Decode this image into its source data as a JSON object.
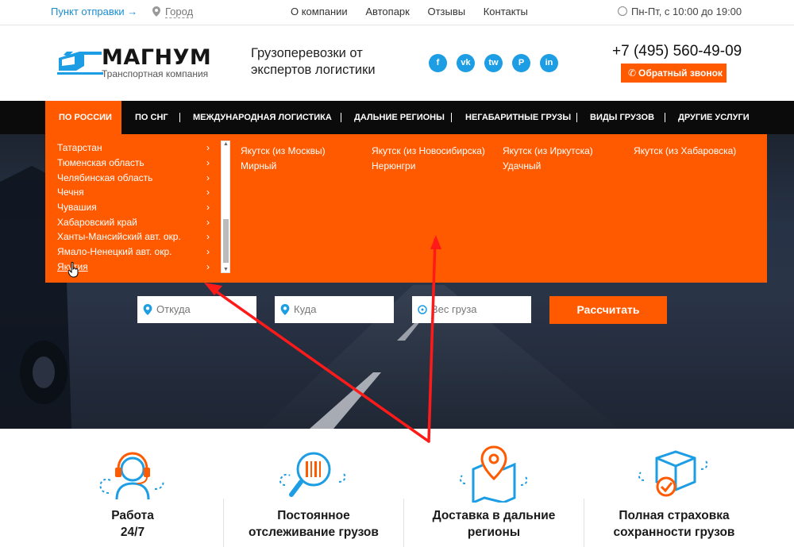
{
  "topbar": {
    "ship_point": "Пункт отправки →",
    "city": "Город",
    "nav": [
      "О компании",
      "Автопарк",
      "Отзывы",
      "Контакты"
    ],
    "hours": "Пн-Пт, с 10:00 до 19:00"
  },
  "header": {
    "brand": "МАГНУМ",
    "brand_sub": "Транспортная компания",
    "slogan_line1": "Грузоперевозки от",
    "slogan_line2": "экспертов логистики",
    "social": [
      "f",
      "vk",
      "tw",
      "P",
      "in"
    ],
    "phone": "+7 (495) 560-49-09",
    "callback": "Обратный звонок"
  },
  "mainnav": {
    "items": [
      "По России",
      "По СНГ",
      "Международная логистика",
      "Дальние регионы",
      "Негабаритные грузы",
      "Виды грузов",
      "Другие услуги"
    ]
  },
  "dropdown": {
    "regions": [
      "Татарстан",
      "Тюменская область",
      "Челябинская область",
      "Чечня",
      "Чувашия",
      "Хабаровский край",
      "Ханты-Мансийский авт. окр.",
      "Ямало-Ненецкий авт. окр.",
      "Якутия"
    ],
    "cities": [
      [
        "Якутск (из Москвы)",
        "Мирный"
      ],
      [
        "Якутск (из Новосибирска)",
        "Нерюнгри"
      ],
      [
        "Якутск (из Иркутска)",
        "Удачный"
      ],
      [
        "Якутск (из Хабаровска)"
      ]
    ]
  },
  "form": {
    "from_placeholder": "Откуда",
    "to_placeholder": "Куда",
    "weight_placeholder": "Вес груза",
    "submit": "Рассчитать"
  },
  "features": [
    {
      "line1": "Работа",
      "line2": "24/7",
      "icon": "headset-icon"
    },
    {
      "line1": "Постоянное",
      "line2": "отслеживание грузов",
      "icon": "tracking-icon"
    },
    {
      "line1": "Доставка в дальние",
      "line2": "регионы",
      "icon": "map-pin-icon"
    },
    {
      "line1": "Полная страховка",
      "line2": "сохранности грузов",
      "icon": "insured-box-icon"
    }
  ],
  "colors": {
    "accent": "#ff5a00",
    "blue": "#1c9de4",
    "nav_bg": "#0b0b0b"
  }
}
